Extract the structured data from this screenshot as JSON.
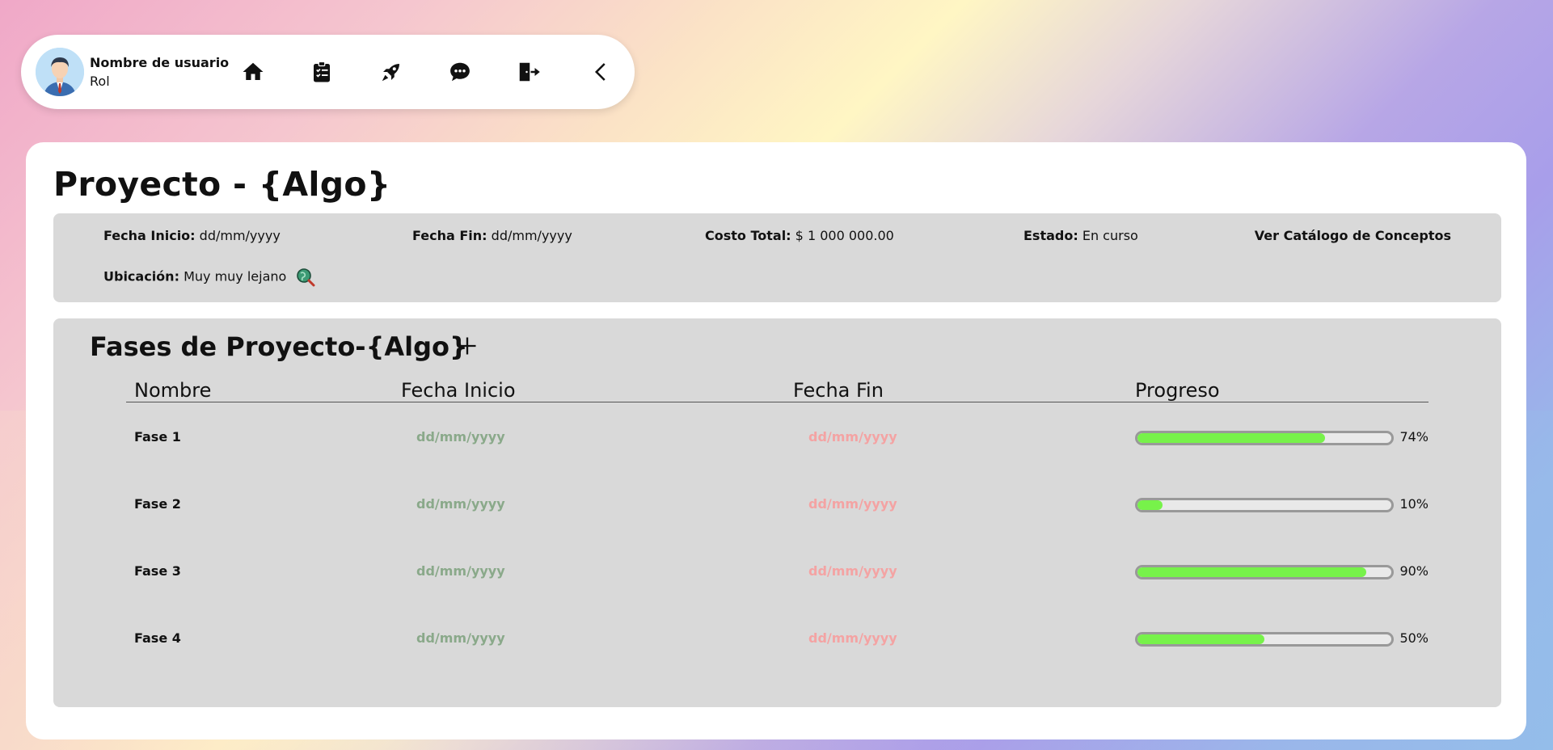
{
  "user": {
    "name": "Nombre de usuario",
    "role": "Rol"
  },
  "nav": [
    {
      "icon": "home-icon"
    },
    {
      "icon": "clipboard-list-icon"
    },
    {
      "icon": "rocket-icon"
    },
    {
      "icon": "chat-icon"
    },
    {
      "icon": "logout-icon"
    },
    {
      "icon": "chevron-left-icon"
    }
  ],
  "project": {
    "title": "Proyecto - {Algo}",
    "start_label": "Fecha Inicio:",
    "start_value": "dd/mm/yyyy",
    "end_label": "Fecha Fin:",
    "end_value": "dd/mm/yyyy",
    "cost_label": "Costo Total:",
    "cost_value": "$ 1 000 000.00",
    "status_label": "Estado:",
    "status_value": "En curso",
    "catalog_link": "Ver Catálogo de Conceptos",
    "location_label": "Ubicación:",
    "location_value": "Muy muy lejano",
    "location_icon": "map-search-icon"
  },
  "phases": {
    "title": "Fases de Proyecto-{Algo}",
    "add_icon": "plus-icon",
    "headers": {
      "name": "Nombre",
      "start": "Fecha Inicio",
      "end": "Fecha Fin",
      "progress": "Progreso"
    },
    "rows": [
      {
        "name": "Fase 1",
        "start": "dd/mm/yyyy",
        "end": "dd/mm/yyyy",
        "progress": 74,
        "progress_label": "74%"
      },
      {
        "name": "Fase 2",
        "start": "dd/mm/yyyy",
        "end": "dd/mm/yyyy",
        "progress": 10,
        "progress_label": "10%"
      },
      {
        "name": "Fase 3",
        "start": "dd/mm/yyyy",
        "end": "dd/mm/yyyy",
        "progress": 90,
        "progress_label": "90%"
      },
      {
        "name": "Fase 4",
        "start": "dd/mm/yyyy",
        "end": "dd/mm/yyyy",
        "progress": 50,
        "progress_label": "50%"
      }
    ]
  },
  "colors": {
    "progress_fill": "#77f24a",
    "start_date": "#8aa98a",
    "end_date": "#f4a3a3",
    "panel": "#d9d9d9"
  }
}
